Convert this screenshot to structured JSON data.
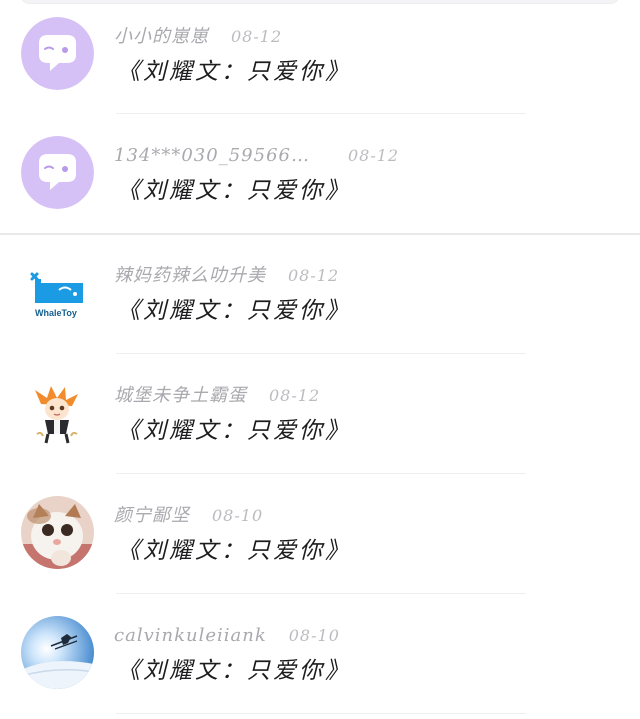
{
  "comments": [
    {
      "username": "小小的崽崽",
      "date": "08-12",
      "text": "《刘耀文：只爱你》",
      "avatar": "purple-chat-bubble-default-avatar"
    },
    {
      "username": "134***030_59566…",
      "date": "08-12",
      "text": "《刘耀文：只爱你》",
      "avatar": "purple-chat-bubble-default-avatar"
    },
    {
      "username": "辣妈药辣么叻升美",
      "date": "08-12",
      "text": "《刘耀文：只爱你》",
      "avatar": "whaletoy-logo-avatar",
      "avatar_label": "WhaleToy"
    },
    {
      "username": "城堡未争土霸蛋",
      "date": "08-12",
      "text": "《刘耀文：只爱你》",
      "avatar": "anime-character-avatar"
    },
    {
      "username": "颜宁鄙坚",
      "date": "08-10",
      "text": "《刘耀文：只爱你》",
      "avatar": "cat-photo-avatar"
    },
    {
      "username": "calvinkuleiiank",
      "date": "08-10",
      "text": "《刘耀文：只爱你》",
      "avatar": "skier-photo-avatar"
    }
  ],
  "colors": {
    "default_avatar_bg": "#d6c1f7",
    "default_avatar_bubble": "#ffffff",
    "username_text": "#a9a9ae",
    "comment_text": "#1d1d1f",
    "whaletoy_blue": "#1a9be4",
    "divider": "#efefef"
  }
}
